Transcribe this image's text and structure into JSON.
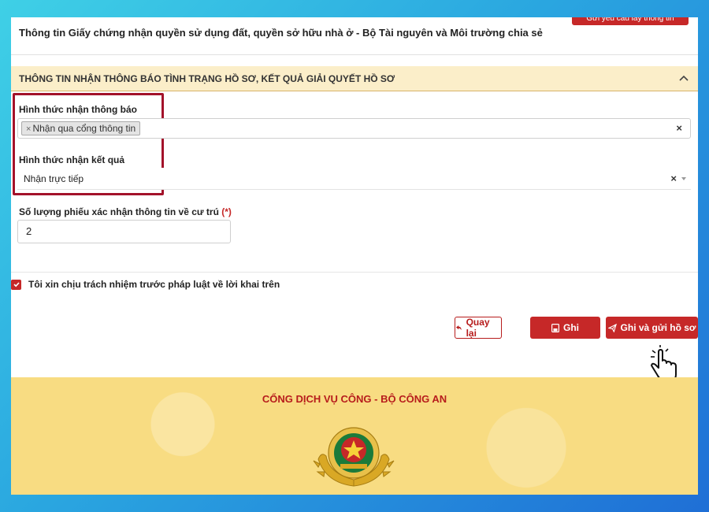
{
  "top": {
    "text": "Thông tin Giấy chứng nhận quyền sử dụng đất, quyền sở hữu nhà ở - Bộ Tài nguyên và Môi trường chia sẻ",
    "cut_button": "Gửi yêu cầu lấy thông tin"
  },
  "section": {
    "title": "THÔNG TIN NHẬN THÔNG BÁO TÌNH TRẠNG HỒ SƠ, KẾT QUẢ GIẢI QUYẾT HỒ SƠ"
  },
  "form": {
    "notify_label": "Hình thức nhận thông báo",
    "notify_tag": "Nhận qua cổng thông tin",
    "result_label": "Hình thức nhận kết quả",
    "result_value": "Nhận trực tiếp",
    "quantity_label": "Số lượng phiếu xác nhận thông tin về cư trú",
    "required_mark": "(*)",
    "quantity_value": "2",
    "clear_symbol": "×"
  },
  "agreement": {
    "text": "Tôi xin chịu trách nhiệm trước pháp luật về lời khai trên",
    "checked": true
  },
  "buttons": {
    "back": "Quay lại",
    "save": "Ghi",
    "submit": "Ghi và gửi hồ sơ"
  },
  "footer": {
    "title": "CỔNG DỊCH VỤ CÔNG - BỘ CÔNG AN"
  },
  "colors": {
    "primary": "#c62828",
    "header_bg": "#fbeec9",
    "footer_bg": "#f8dc82"
  }
}
